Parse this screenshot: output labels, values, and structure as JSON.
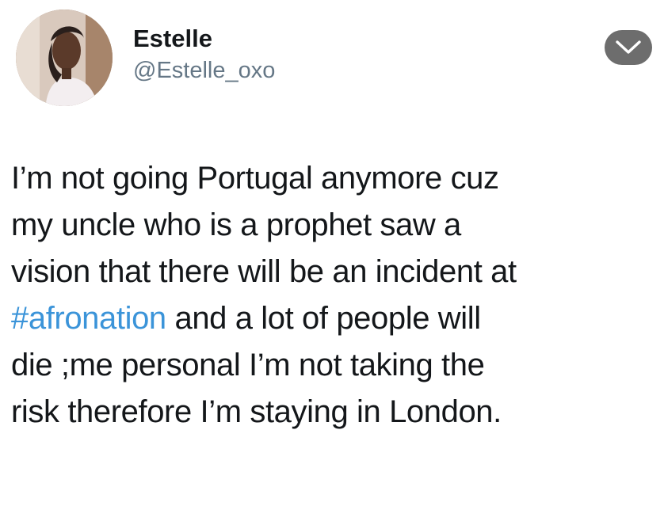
{
  "user": {
    "display_name": "Estelle",
    "handle": "@Estelle_oxo"
  },
  "tweet": {
    "line1": "I’m not going Portugal anymore cuz",
    "line2": "my uncle who is a prophet saw a",
    "line3": "vision that there will be an incident  at",
    "hashtag": "#afronation",
    "line4_rest": " and a lot of people will",
    "line5": "die ;me personal I’m not taking the",
    "line6": "risk therefore I’m staying in London."
  },
  "icons": {
    "avatar": "profile-photo",
    "menu": "chevron-down-icon"
  },
  "colors": {
    "hashtag": "#3b94d9",
    "handle": "#657786",
    "menu_button": "#6d6d6d"
  }
}
